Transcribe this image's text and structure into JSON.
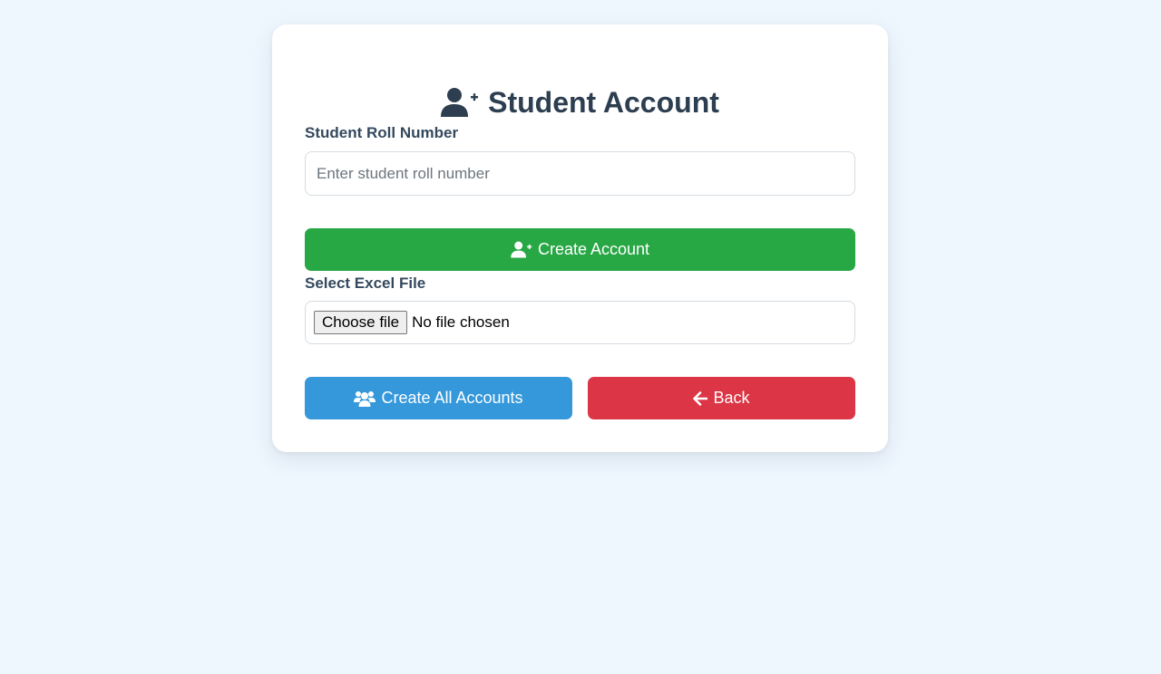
{
  "header": {
    "title": "Student Account",
    "icon": "user-plus-icon"
  },
  "form": {
    "roll_label": "Student Roll Number",
    "roll_placeholder": "Enter student roll number",
    "roll_value": "",
    "create_button_label": "Create Account",
    "create_button_icon": "user-plus-icon",
    "excel_label": "Select Excel File",
    "file_button_label": "Choose file",
    "file_status": "No file chosen",
    "create_all_button_label": "Create All Accounts",
    "create_all_button_icon": "users-icon",
    "back_button_label": "Back",
    "back_button_icon": "arrow-left-icon"
  },
  "colors": {
    "background": "#eef6fe",
    "title": "#2c3e50",
    "create": "#28a745",
    "create_all": "#3498db",
    "back": "#dc3545"
  }
}
